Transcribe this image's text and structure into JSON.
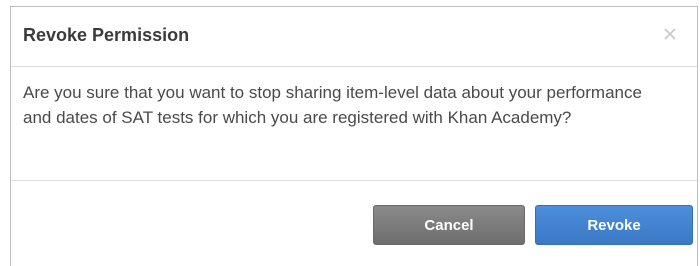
{
  "dialog": {
    "title": "Revoke Permission",
    "close_icon": "close-icon",
    "message": "Are you sure that you want to stop sharing item-level data about your performance and dates of SAT tests for which you are registered with Khan Academy?",
    "cancel_label": "Cancel",
    "revoke_label": "Revoke"
  },
  "colors": {
    "cancel_button": "#7b7b7b",
    "revoke_button": "#4384d1",
    "title_text": "#3b3b3b",
    "body_text": "#4a4a4a"
  }
}
